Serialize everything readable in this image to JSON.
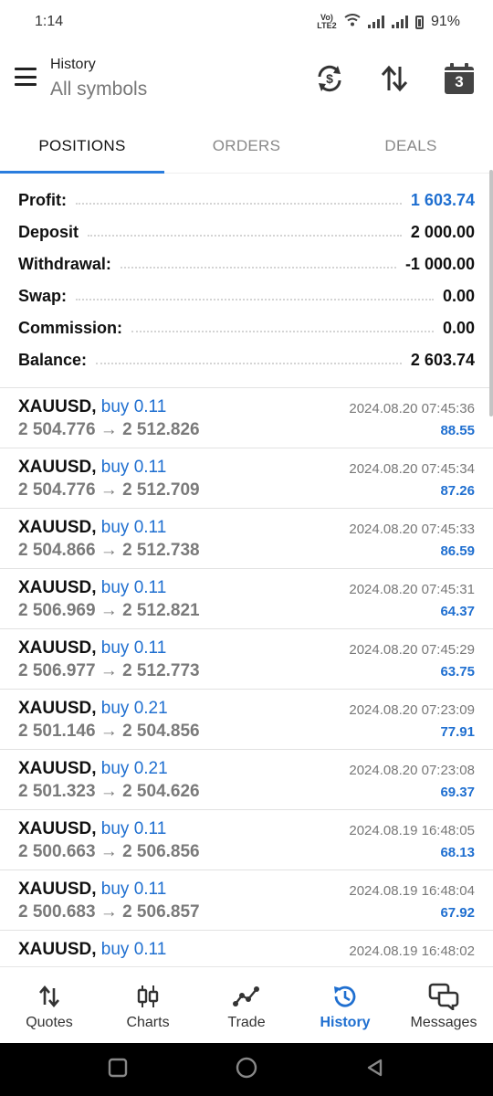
{
  "status": {
    "time": "1:14",
    "network": "Vo) LTE2",
    "battery": "91%"
  },
  "header": {
    "title": "History",
    "subtitle": "All symbols",
    "calendar_day": "3"
  },
  "tabs": [
    {
      "label": "POSITIONS",
      "active": true
    },
    {
      "label": "ORDERS",
      "active": false
    },
    {
      "label": "DEALS",
      "active": false
    }
  ],
  "summary": {
    "profit_label": "Profit:",
    "profit_value": "1 603.74",
    "deposit_label": "Deposit",
    "deposit_value": "2 000.00",
    "withdrawal_label": "Withdrawal:",
    "withdrawal_value": "-1 000.00",
    "swap_label": "Swap:",
    "swap_value": "0.00",
    "commission_label": "Commission:",
    "commission_value": "0.00",
    "balance_label": "Balance:",
    "balance_value": "2 603.74"
  },
  "positions": [
    {
      "symbol": "XAUUSD,",
      "direction": "buy 0.11",
      "prices": "2 504.776 → 2 512.826",
      "time": "2024.08.20 07:45:36",
      "profit": "88.55"
    },
    {
      "symbol": "XAUUSD,",
      "direction": "buy 0.11",
      "prices": "2 504.776 → 2 512.709",
      "time": "2024.08.20 07:45:34",
      "profit": "87.26"
    },
    {
      "symbol": "XAUUSD,",
      "direction": "buy 0.11",
      "prices": "2 504.866 → 2 512.738",
      "time": "2024.08.20 07:45:33",
      "profit": "86.59"
    },
    {
      "symbol": "XAUUSD,",
      "direction": "buy 0.11",
      "prices": "2 506.969 → 2 512.821",
      "time": "2024.08.20 07:45:31",
      "profit": "64.37"
    },
    {
      "symbol": "XAUUSD,",
      "direction": "buy 0.11",
      "prices": "2 506.977 → 2 512.773",
      "time": "2024.08.20 07:45:29",
      "profit": "63.75"
    },
    {
      "symbol": "XAUUSD,",
      "direction": "buy 0.21",
      "prices": "2 501.146 → 2 504.856",
      "time": "2024.08.20 07:23:09",
      "profit": "77.91"
    },
    {
      "symbol": "XAUUSD,",
      "direction": "buy 0.21",
      "prices": "2 501.323 → 2 504.626",
      "time": "2024.08.20 07:23:08",
      "profit": "69.37"
    },
    {
      "symbol": "XAUUSD,",
      "direction": "buy 0.11",
      "prices": "2 500.663 → 2 506.856",
      "time": "2024.08.19 16:48:05",
      "profit": "68.13"
    },
    {
      "symbol": "XAUUSD,",
      "direction": "buy 0.11",
      "prices": "2 500.683 → 2 506.857",
      "time": "2024.08.19 16:48:04",
      "profit": "67.92"
    },
    {
      "symbol": "XAUUSD,",
      "direction": "buy 0.11",
      "prices": "",
      "time": "2024.08.19 16:48:02",
      "profit": ""
    }
  ],
  "bottom_nav": [
    {
      "label": "Quotes",
      "icon": "up-down-arrows-icon",
      "active": false
    },
    {
      "label": "Charts",
      "icon": "candlestick-icon",
      "active": false
    },
    {
      "label": "Trade",
      "icon": "trend-line-icon",
      "active": false
    },
    {
      "label": "History",
      "icon": "history-clock-icon",
      "active": true
    },
    {
      "label": "Messages",
      "icon": "chat-bubbles-icon",
      "active": false
    }
  ],
  "colors": {
    "accent": "#1f6fd0",
    "tab_underline": "#2a7dde",
    "muted": "#777777"
  }
}
